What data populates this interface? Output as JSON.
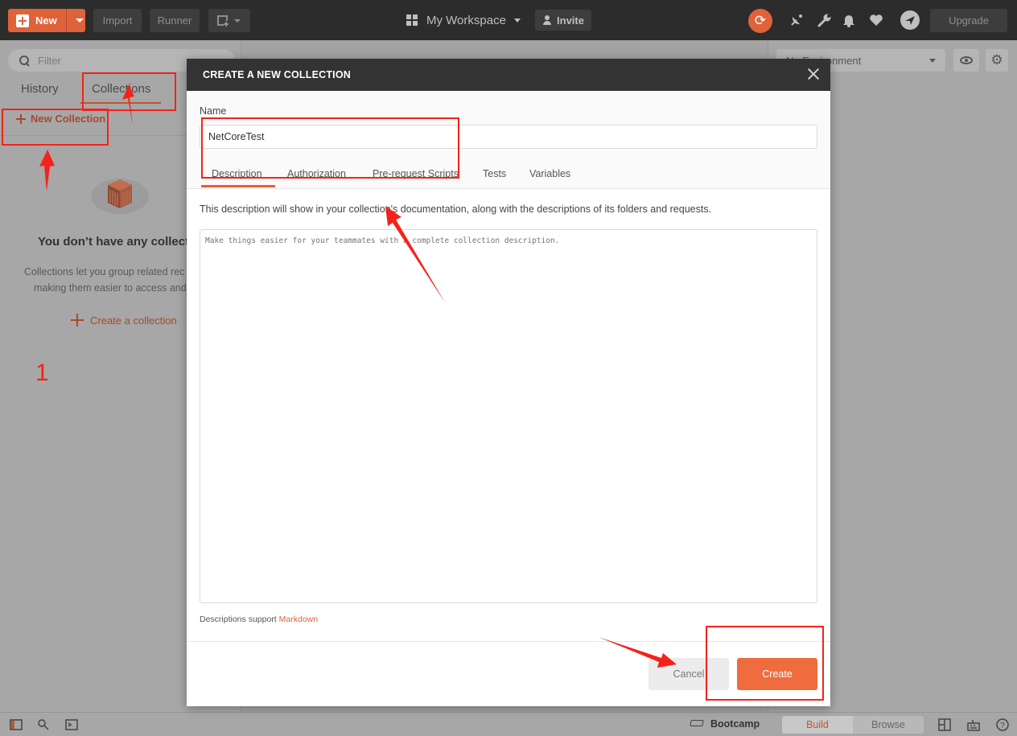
{
  "topbar": {
    "new_label": "New",
    "import_label": "Import",
    "runner_label": "Runner",
    "workspace_label": "My Workspace",
    "invite_label": "Invite",
    "upgrade_label": "Upgrade"
  },
  "sidebar": {
    "filter_placeholder": "Filter",
    "tabs": [
      {
        "label": "History",
        "active": false
      },
      {
        "label": "Collections",
        "active": true
      }
    ],
    "new_collection_label": "New Collection",
    "empty_title": "You don’t have any collectio",
    "empty_desc_line1": "Collections let you group related rec",
    "empty_desc_line2": "making them easier to access and",
    "create_link_label": "Create a collection"
  },
  "environment": {
    "selected": "No Environment"
  },
  "statusbar": {
    "bootcamp_label": "Bootcamp",
    "build_label": "Build",
    "browse_label": "Browse"
  },
  "modal": {
    "title": "CREATE A NEW COLLECTION",
    "name_label": "Name",
    "name_value": "NetCoreTest",
    "tabs": [
      {
        "label": "Description",
        "active": true
      },
      {
        "label": "Authorization",
        "active": false
      },
      {
        "label": "Pre-request Scripts",
        "active": false
      },
      {
        "label": "Tests",
        "active": false
      },
      {
        "label": "Variables",
        "active": false
      }
    ],
    "description_help": "This description will show in your collection's documentation, along with the descriptions of its folders and requests.",
    "description_placeholder": "Make things easier for your teammates with a complete collection description.",
    "markdown_note_prefix": "Descriptions support ",
    "markdown_link": "Markdown",
    "cancel_label": "Cancel",
    "create_label": "Create"
  },
  "annotation": {
    "step_number": "1"
  },
  "colors": {
    "accent": "#ef6c3e",
    "annotation_red": "#f5221b",
    "topbar_bg": "#2c2c2c",
    "modal_header_bg": "#333333"
  }
}
